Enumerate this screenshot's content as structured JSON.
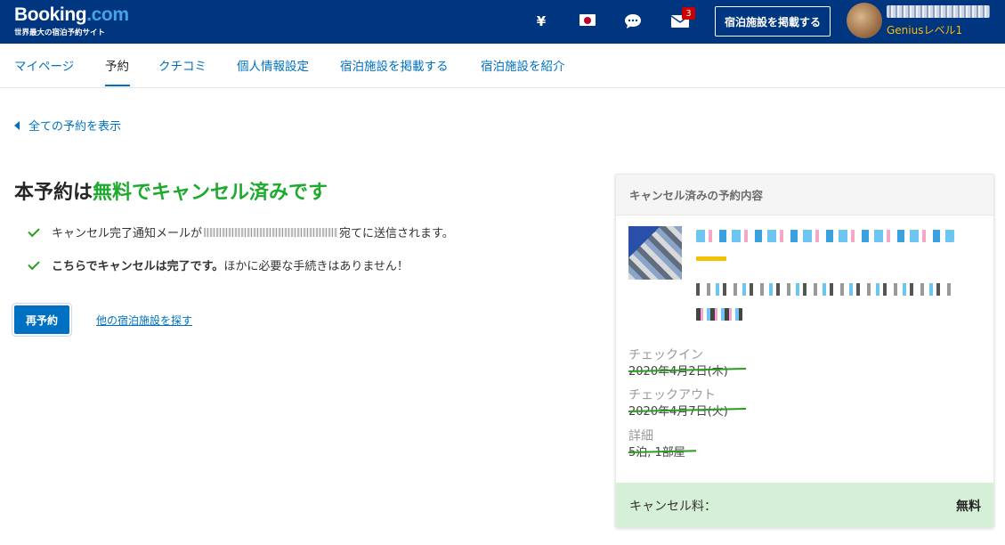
{
  "header": {
    "logo_main": "Booking",
    "logo_tld": ".com",
    "tagline": "世界最大の宿泊予約サイト",
    "currency": "¥",
    "mail_badge": "3",
    "list_property": "宿泊施設を掲載する",
    "genius": "Geniusレベル1"
  },
  "nav": {
    "items": [
      "マイページ",
      "予約",
      "クチコミ",
      "個人情報設定",
      "宿泊施設を掲載する",
      "宿泊施設を紹介"
    ],
    "active_index": 1
  },
  "back_link": "全ての予約を表示",
  "main": {
    "title_prefix": "本予約は",
    "title_highlight": "無料でキャンセル済みです",
    "line1_prefix": "キャンセル完了通知メールが",
    "line1_suffix": "宛てに送信されます。",
    "line2_bold": "こちらでキャンセルは完了です。",
    "line2_rest": "ほかに必要な手続きはありません！",
    "rebook": "再予約",
    "find_other": "他の宿泊施設を探す"
  },
  "card": {
    "heading": "キャンセル済みの予約内容",
    "checkin_label": "チェックイン",
    "checkin_value": "2020年4月2日(木)",
    "checkout_label": "チェックアウト",
    "checkout_value": "2020年4月7日(火)",
    "details_label": "詳細",
    "details_value": "5泊, 1部屋",
    "fee_label": "キャンセル料：",
    "fee_value": "無料"
  },
  "colors": {
    "brand_blue": "#003580",
    "link_blue": "#0071c2",
    "success_green": "#1eaa2d",
    "fee_bg": "#d6efd7",
    "genius_yellow": "#febb02"
  }
}
